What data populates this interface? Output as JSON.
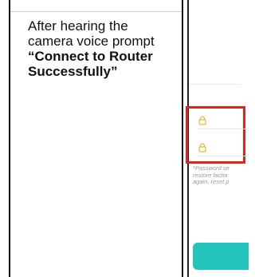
{
  "instruction": {
    "prefix": "After hearing the camera voice prompt ",
    "emphasis": "“Connect to Router Successfully”"
  },
  "phone_screen": {
    "password_note_lines": [
      "*Password se",
      "restore factor",
      "again, reset p"
    ],
    "highlight_color": "#e2231a",
    "button_color": "#22c4bb",
    "field_icon": "lock-icon"
  }
}
